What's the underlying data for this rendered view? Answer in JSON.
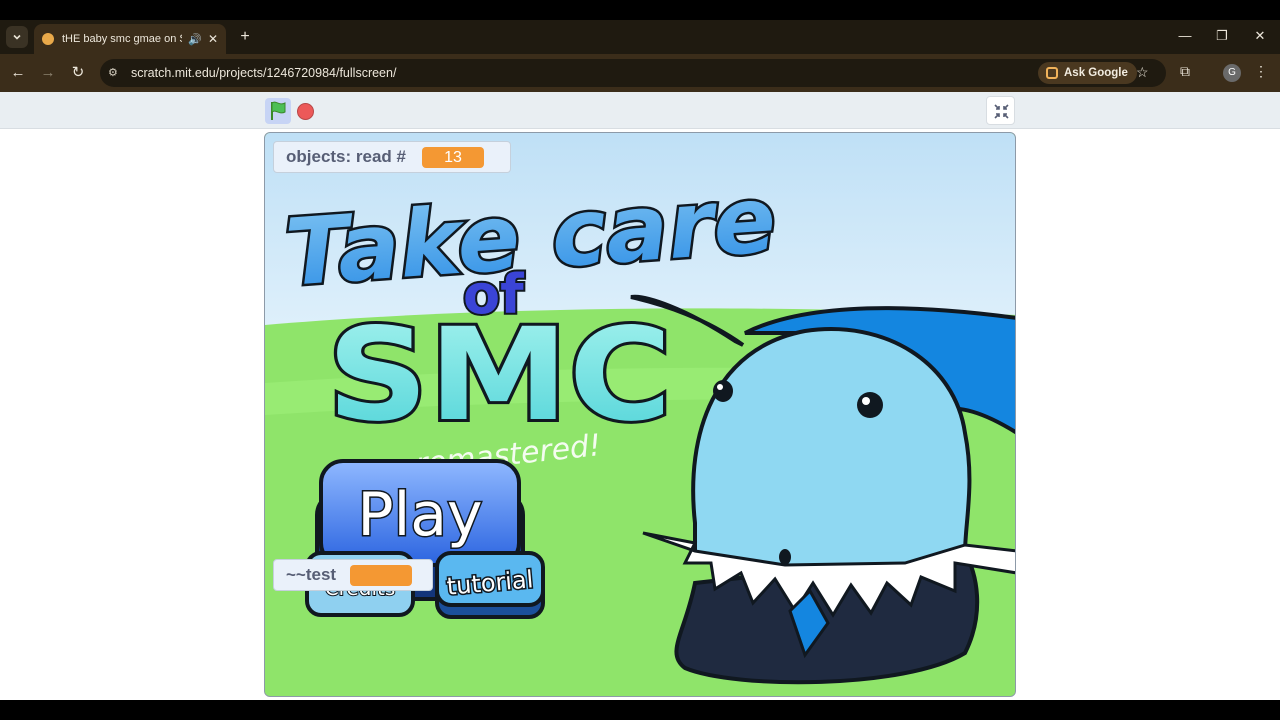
{
  "browser": {
    "tab_title": "tHE baby smc gmae on Scr",
    "url": "scratch.mit.edu/projects/1246720984/fullscreen/",
    "ask_google_label": "Ask Google",
    "profile_initial": "G",
    "icons": {
      "tab_menu": "chevron-down-icon",
      "audio": "speaker-icon",
      "close": "close-icon",
      "new_tab": "plus-icon",
      "back": "arrow-left-icon",
      "forward": "arrow-right-icon",
      "reload": "reload-icon",
      "site_info": "tune-icon",
      "bookmark": "star-icon",
      "extensions": "puzzle-icon",
      "menu": "kebab-icon"
    }
  },
  "scratch": {
    "icons": {
      "green_flag": "green-flag-icon",
      "stop": "stop-icon",
      "exit_fullscreen": "exit-fullscreen-icon"
    },
    "monitors": {
      "objects": {
        "label": "objects: read #",
        "value": "13"
      },
      "test": {
        "label": "~~test",
        "value": ""
      }
    },
    "game": {
      "title_line1": "Take care",
      "title_of": "of",
      "title_line2": "SMC",
      "subtitle": "remastered!",
      "play_label": "Play",
      "tutorial_label": "tutorial",
      "hidden_button_label": "Credits"
    }
  },
  "colors": {
    "sky": "#c9e7f7",
    "grass": "#8fe46a",
    "character_body": "#8fd8f2",
    "character_hair": "#1486e0",
    "character_outfit": "#1f2a40",
    "monitor_value": "#f49833",
    "title_blue": "#4aa3ea",
    "title_cyan": "#7ee6e0",
    "play_button": "#2f6fe0"
  }
}
